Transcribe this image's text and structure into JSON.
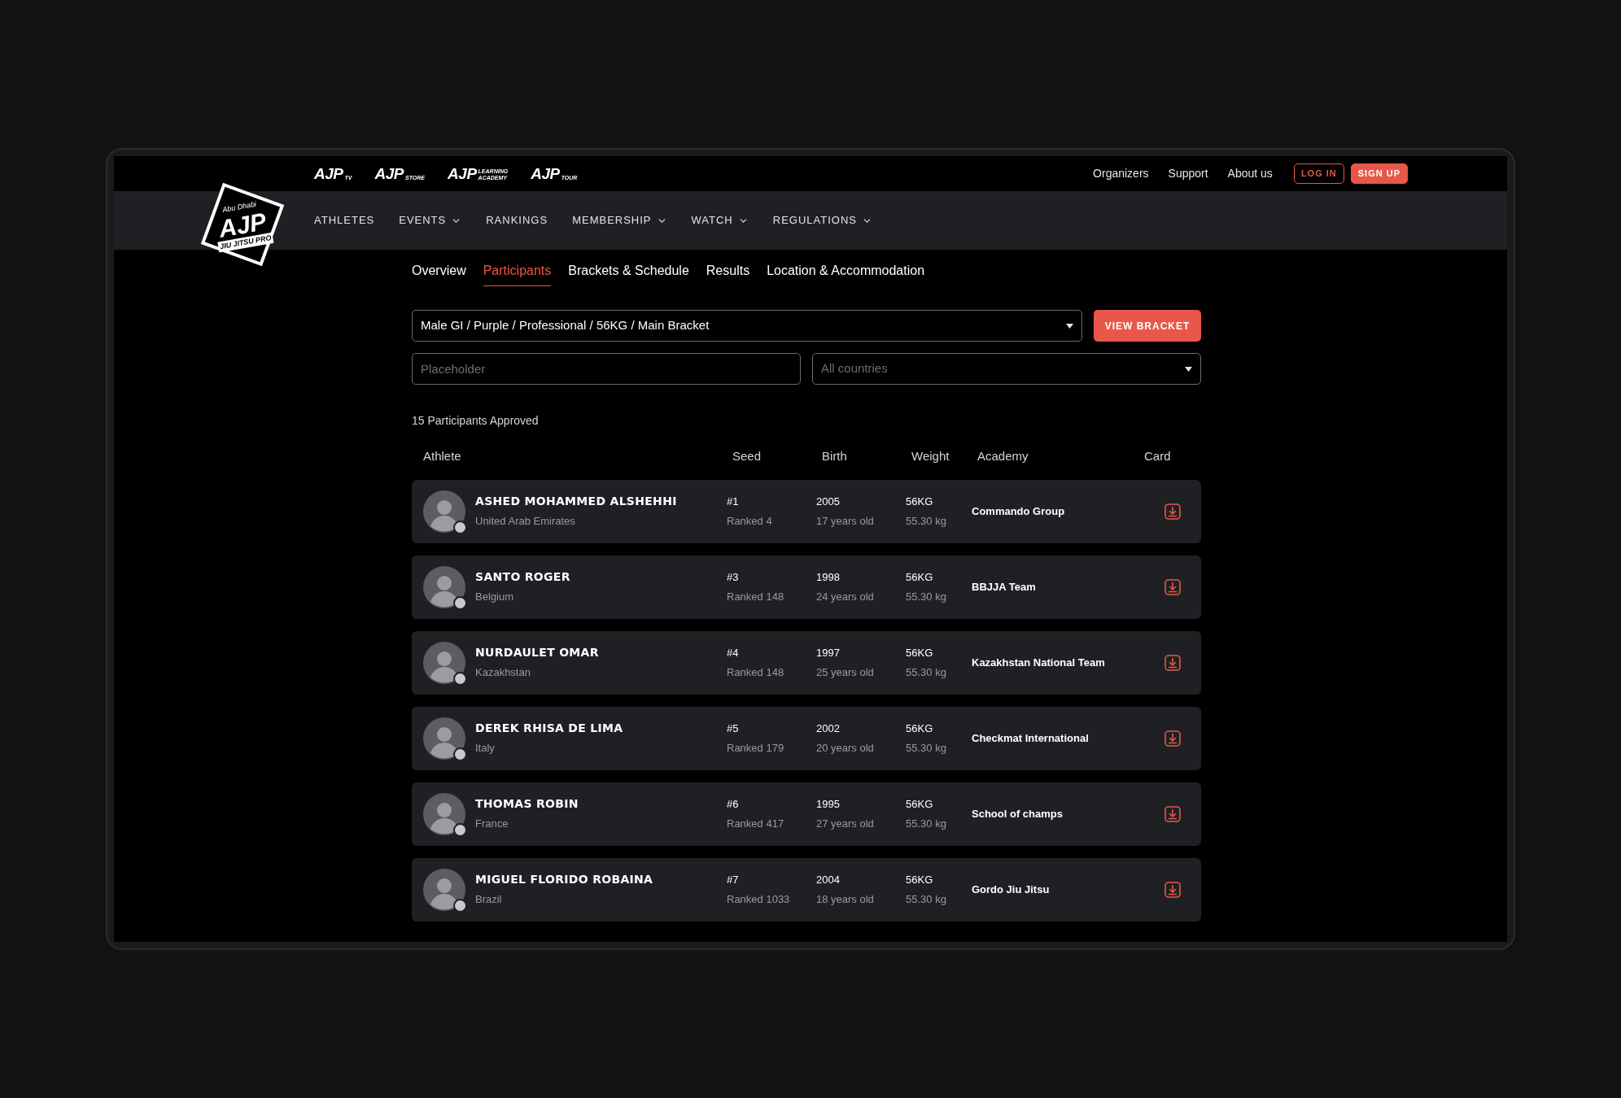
{
  "brand": {
    "small": "Abu Dhabi",
    "mark": "AJP",
    "sub": "JIU JITSU PRO"
  },
  "sub_brands": [
    {
      "mark": "AJP",
      "tag": "TV"
    },
    {
      "mark": "AJP",
      "tag": "STORE"
    },
    {
      "mark": "AJP",
      "tag": "LEARNING ACADEMY"
    },
    {
      "mark": "AJP",
      "tag": "TOUR"
    }
  ],
  "top_links": [
    "Organizers",
    "Support",
    "About us"
  ],
  "auth_buttons": [
    {
      "label": "LOG IN",
      "kind": "outline"
    },
    {
      "label": "SIGN UP",
      "kind": "filled"
    }
  ],
  "nav": [
    {
      "label": "ATHLETES",
      "dropdown": false
    },
    {
      "label": "EVENTS",
      "dropdown": true
    },
    {
      "label": "RANKINGS",
      "dropdown": false
    },
    {
      "label": "MEMBERSHIP",
      "dropdown": true
    },
    {
      "label": "WATCH",
      "dropdown": true
    },
    {
      "label": "REGULATIONS",
      "dropdown": true
    }
  ],
  "tabs": [
    {
      "label": "Overview",
      "selected": false
    },
    {
      "label": "Participants",
      "selected": true
    },
    {
      "label": "Brackets & Schedule",
      "selected": false
    },
    {
      "label": "Results",
      "selected": false
    },
    {
      "label": "Location & Accommodation",
      "selected": false
    }
  ],
  "bracket_select": {
    "value": "Male GI / Purple / Professional / 56KG / Main Bracket"
  },
  "view_bracket_button": "VIEW BRACKET",
  "search": {
    "placeholder": "Placeholder"
  },
  "country_select": {
    "placeholder": "All countries"
  },
  "count": "15 Participants Approved",
  "columns": [
    "Athlete",
    "Seed",
    "Birth",
    "Weight",
    "Academy",
    "Card"
  ],
  "rows": [
    {
      "name": "ASHED MOHAMMED ALSHEHHI",
      "country": "United Arab Emirates",
      "seed": "#1",
      "rank": "Ranked 4",
      "year": "2005",
      "age": "17 years old",
      "weight_class": "56KG",
      "weight": "55.30 kg",
      "academy": "Commando Group"
    },
    {
      "name": "SANTO ROGER",
      "country": "Belgium",
      "seed": "#3",
      "rank": "Ranked 148",
      "year": "1998",
      "age": "24 years old",
      "weight_class": "56KG",
      "weight": "55.30 kg",
      "academy": "BBJJA Team"
    },
    {
      "name": "NURDAULET OMAR",
      "country": "Kazakhstan",
      "seed": "#4",
      "rank": "Ranked 148",
      "year": "1997",
      "age": "25 years old",
      "weight_class": "56KG",
      "weight": "55.30 kg",
      "academy": "Kazakhstan National Team"
    },
    {
      "name": "DEREK RHISA DE LIMA",
      "country": "Italy",
      "seed": "#5",
      "rank": "Ranked 179",
      "year": "2002",
      "age": "20 years old",
      "weight_class": "56KG",
      "weight": "55.30 kg",
      "academy": "Checkmat International"
    },
    {
      "name": "THOMAS ROBIN",
      "country": "France",
      "seed": "#6",
      "rank": "Ranked 417",
      "year": "1995",
      "age": "27 years old",
      "weight_class": "56KG",
      "weight": "55.30 kg",
      "academy": "School of champs"
    },
    {
      "name": "MIGUEL FLORIDO ROBAINA",
      "country": "Brazil",
      "seed": "#7",
      "rank": "Ranked 1033",
      "year": "2004",
      "age": "18 years old",
      "weight_class": "56KG",
      "weight": "55.30 kg",
      "academy": "Gordo Jiu Jitsu"
    }
  ]
}
